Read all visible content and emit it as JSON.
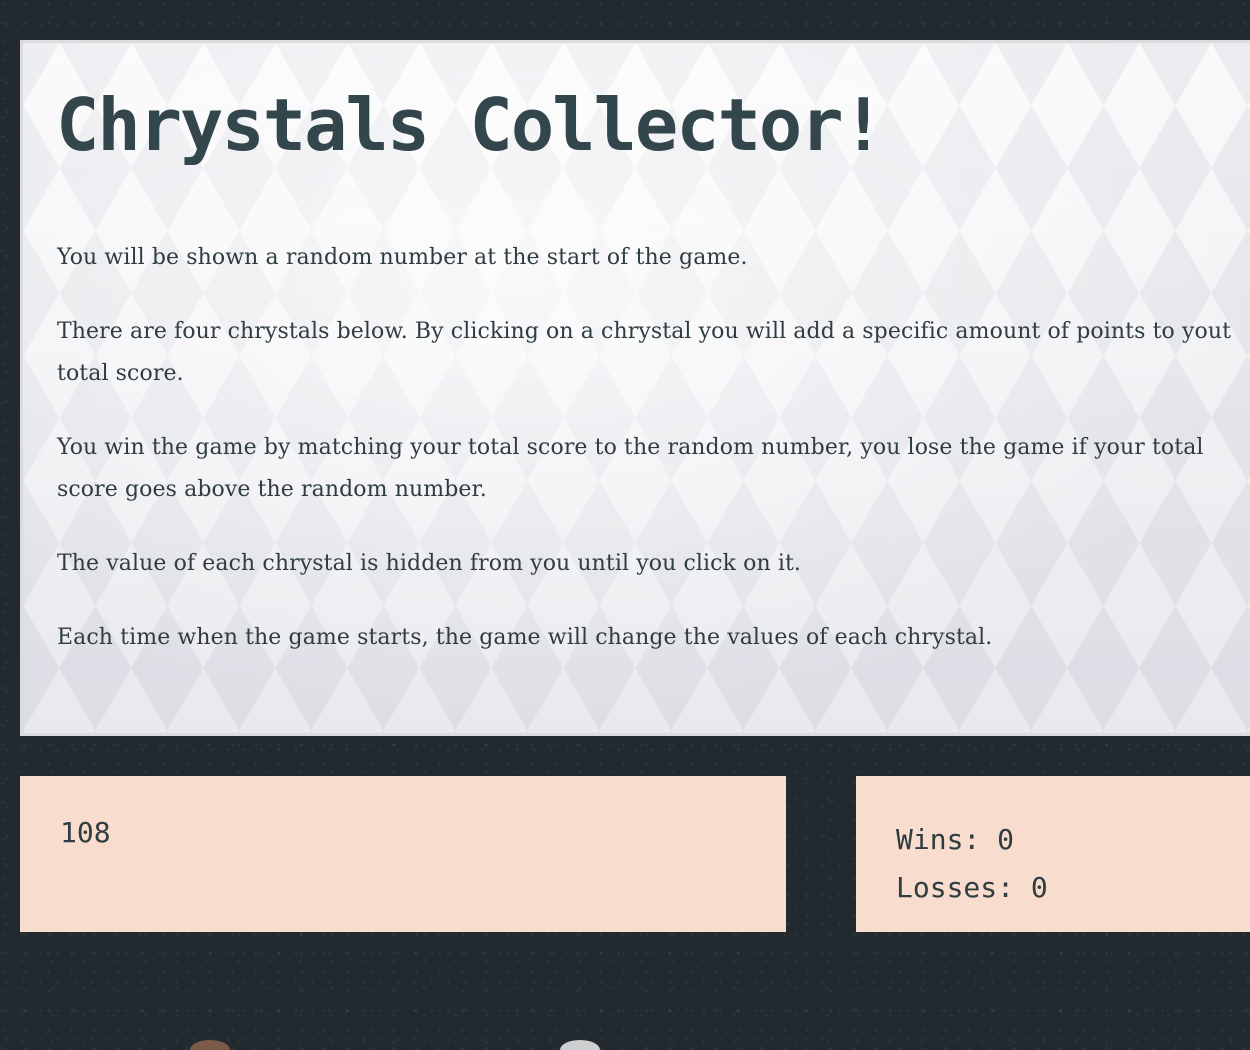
{
  "header": {
    "title": "Chrystals Collector!"
  },
  "instructions": [
    "You will be shown a random number at the start of the game.",
    "There are four chrystals below. By clicking on a chrystal you will add a specific amount of points to yout total score.",
    "You win the game by matching your total score to the random number, you lose the game if your total score goes above the random number.",
    "The value of each chrystal is hidden from you until you click on it.",
    "Each time when the game starts, the game will change the values of each chrystal."
  ],
  "game": {
    "random_number": "108",
    "wins_label": "Wins:",
    "wins_value": "0",
    "losses_label": "Losses:",
    "losses_value": "0"
  },
  "colors": {
    "background": "#232a2f",
    "panel": "#f8dccd",
    "text": "#32464c"
  }
}
